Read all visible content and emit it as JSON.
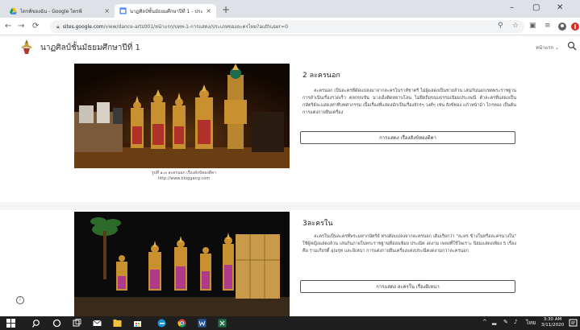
{
  "browser": {
    "tabs": [
      {
        "title": "ไดรฟ์ของฉัน - Google ไดรฟ์",
        "close": "×"
      },
      {
        "title": "นาฏศิลป์ชั้นมัธยมศึกษาปีที่ 1 - ประเภท",
        "close": "×"
      }
    ],
    "new_tab": "+",
    "window_controls": {
      "minimize": "–",
      "maximize": "▢",
      "close": "✕"
    },
    "url_host": "sites.google.com",
    "url_path": "/view/dance-arts001/หน้าแรก/บทท-1-การแสดง/ประเภทของละครไทย?authuser=0"
  },
  "site": {
    "title": "นาฏศิลป์ชั้นมัธยมศึกษาปีที่ 1",
    "more_pages": "หน้าแรก ⌄"
  },
  "section1": {
    "heading": "2 ละครนอก",
    "paragraph": "ละครนอก เป็นละครที่ดัดแปลงมาจากละครโนราห์ชาตรี ไม่ผู้แสดงเป็นชายล้วน เล่นกันนอกเขตพระราชฐาน การดำเนินเรื่องรวดเร็ว ตลกขบขัน นางเอ็งติดหยาบโลน ไม่ยึดถือขนบธรรมเนียมประเพณี ตัวละครที่แสดงเป็น กษัตริย์จะแสดงท่าทีบทศากรรม เนื้อเรื่องที่แสดงมักเป็นเรื่องจักรๆ วงศ์ๆ เช่น สังข์ทอง แก้วหน้าม้า ไกรทอง เป็นต้น การแต่งกายยืนเครื่อง",
    "button": "การแสดง เรื่องสังข์ทองตีคา",
    "caption_line1": "รูปที่ ๑.๓ ละครนอก เรื่องสังข์ทองตีคา",
    "caption_line2": "http://www.bloggang.com"
  },
  "section2": {
    "heading": "3ละครใน",
    "paragraph": "ละครในเป็นละครที่พระมหากษัตริย์ ทรงดัดแปลงจากละครนอก เดิมเรียกว่า \"ละคร ข้างในหรือละครนางใน\" ใช้ผู้หญิงแสดงล้วน เล่นกันภายในพระราชฐานที่อ่อนช้อย ประณีต งดงาม เพลงที่ใช้ไพเราะ นิยมแสดงเพียง 5 เรื่อง คือ รามเกียรติ์ อุณรุท และอิเหนา การแต่งกายยืนเครื่องแต่งประณีตงดงามกว่าละครนอก",
    "button": "การแสดง ละครใน เรื่องอิเหนา"
  },
  "info_icon": "i",
  "taskbar": {
    "time": "3:30 AM",
    "date": "3/11/2020"
  },
  "colors": {
    "accent": "#1a73e8",
    "taskbar": "#1f1f1f",
    "tabstrip": "#dee1e6"
  }
}
